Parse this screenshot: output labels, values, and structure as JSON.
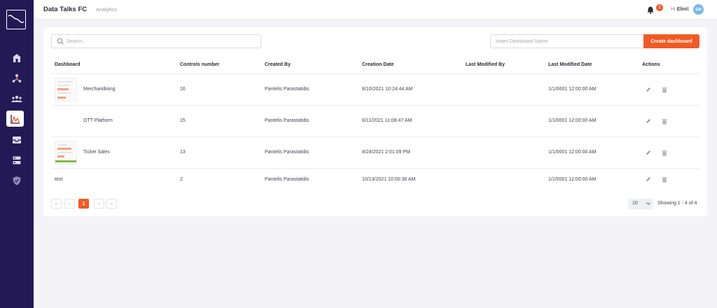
{
  "header": {
    "app_title": "Data Talks FC",
    "section": "Analytics",
    "notification_count": "1",
    "greeting_prefix": "Hi",
    "user_name": "Elini!",
    "avatar_initials": "EM"
  },
  "sidebar": {
    "items": [
      {
        "icon": "home-icon"
      },
      {
        "icon": "network-icon"
      },
      {
        "icon": "users-icon"
      },
      {
        "icon": "analytics-icon",
        "active": true
      },
      {
        "icon": "inbox-icon"
      },
      {
        "icon": "database-icon"
      },
      {
        "icon": "shield-icon"
      }
    ]
  },
  "toolbar": {
    "search_placeholder": "Search...",
    "dashboard_name_placeholder": "Insert Dashboard Name",
    "create_label": "Create dashboard"
  },
  "table": {
    "columns": [
      "Dashboard",
      "Controls number",
      "Created By",
      "Creation Date",
      "Last Modified By",
      "Last Modified Date",
      "Actions"
    ],
    "rows": [
      {
        "name": "Merchandising",
        "controls": "16",
        "created_by": "Pantelis Parastatidis",
        "creation_date": "8/10/2021 10:24:44 AM",
        "modified_by": "",
        "modified_date": "1/1/0001 12:00:00 AM",
        "thumb": "orange"
      },
      {
        "name": "OTT Platform",
        "controls": "15",
        "created_by": "Pantelis Parastatidis",
        "creation_date": "8/11/2021 11:08:47 AM",
        "modified_by": "",
        "modified_date": "1/1/0001 12:00:00 AM",
        "thumb": "none"
      },
      {
        "name": "Ticket Sales",
        "controls": "13",
        "created_by": "Pantelis Parastatidis",
        "creation_date": "8/24/2021 2:01:09 PM",
        "modified_by": "",
        "modified_date": "1/1/0001 12:00:00 AM",
        "thumb": "green"
      },
      {
        "name": "test",
        "controls": "2",
        "created_by": "Pantelis Parastatidis",
        "creation_date": "10/13/2021 10:00:36 AM",
        "modified_by": "",
        "modified_date": "1/1/0001 12:00:00 AM",
        "thumb": "none"
      }
    ]
  },
  "pagination": {
    "first": "«",
    "prev": "‹",
    "current": "1",
    "next": "›",
    "last": "»",
    "page_size": "10",
    "showing": "Showing 1 - 4 of 4"
  },
  "colors": {
    "accent": "#f15a24",
    "sidebar": "#231a55"
  }
}
